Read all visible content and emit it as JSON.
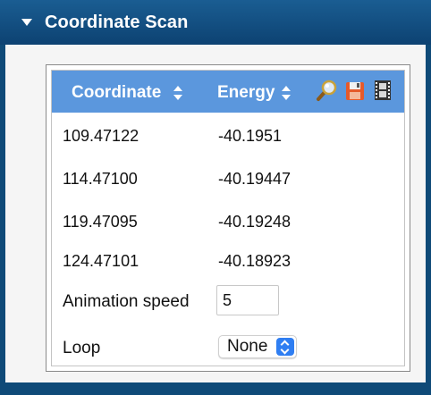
{
  "titlebar": {
    "title": "Coordinate Scan",
    "caret_icon": "collapse-triangle-icon"
  },
  "table": {
    "columns": [
      "Coordinate",
      "Energy"
    ],
    "toolbar_icons": [
      "magnifier-icon",
      "save-icon",
      "film-strip-icon"
    ],
    "rows": [
      {
        "coordinate": "109.47122",
        "energy": "-40.1951"
      },
      {
        "coordinate": "114.47100",
        "energy": "-40.19447"
      },
      {
        "coordinate": "119.47095",
        "energy": "-40.19248"
      },
      {
        "coordinate": "124.47101",
        "energy": "-40.18923"
      }
    ]
  },
  "animation": {
    "label": "Animation speed",
    "value": "5"
  },
  "loop": {
    "label": "Loop",
    "selected": "None"
  },
  "colors": {
    "title_bar": "#0d4272",
    "table_header": "#5b97dd",
    "select_accent": "#2f7ef2"
  }
}
